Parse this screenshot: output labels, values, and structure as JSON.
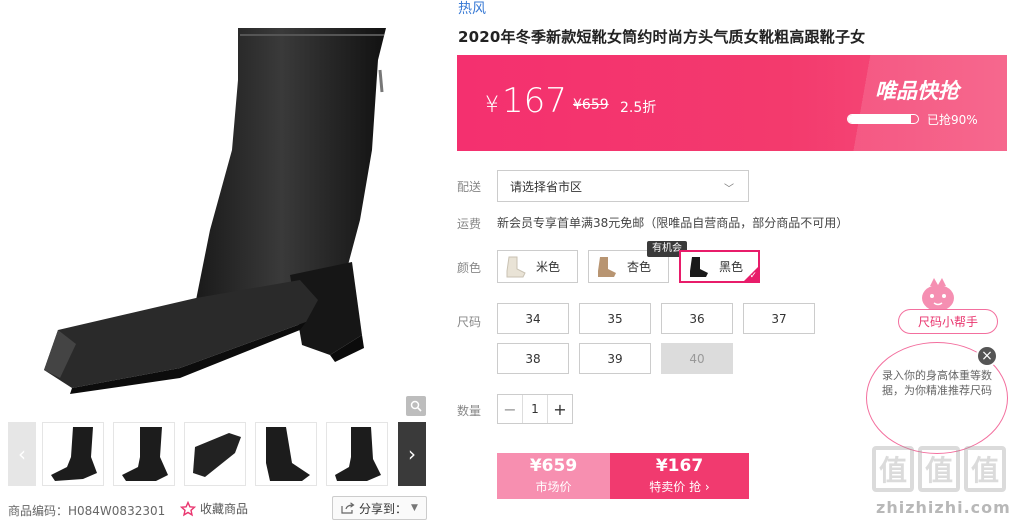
{
  "product": {
    "brand": "热风",
    "title": "2020年冬季新款短靴女筒约时尚方头气质女靴粗高跟靴子女",
    "sku_label": "商品编码：H084W0832301",
    "favorite_label": "收藏商品",
    "share_label": "分享到："
  },
  "price": {
    "current": "167",
    "currency": "¥",
    "original": "¥659",
    "discount": "2.5折"
  },
  "flash_sale": {
    "title": "唯品快抢",
    "progress_text": "已抢90%",
    "progress_fraction": 0.9
  },
  "shipping": {
    "label": "配送",
    "select_value": "请选择省市区"
  },
  "fee": {
    "label": "运费",
    "text": "新会员专享首单满38元免邮（限唯品自营商品，部分商品不可用）"
  },
  "colors": {
    "label": "颜色",
    "chance_badge": "有机会",
    "options": [
      {
        "name": "米色",
        "selected": false
      },
      {
        "name": "杏色",
        "selected": false
      },
      {
        "name": "黑色",
        "selected": true
      }
    ]
  },
  "sizes": {
    "label": "尺码",
    "options": [
      {
        "value": "34",
        "available": true
      },
      {
        "value": "35",
        "available": true
      },
      {
        "value": "36",
        "available": true
      },
      {
        "value": "37",
        "available": true
      },
      {
        "value": "38",
        "available": true
      },
      {
        "value": "39",
        "available": true
      },
      {
        "value": "40",
        "available": false
      }
    ]
  },
  "quantity": {
    "label": "数量",
    "value": "1"
  },
  "buy": {
    "market_price": "¥659",
    "market_label": "市场价",
    "special_price": "¥167",
    "special_label": "特卖价 抢 ›"
  },
  "helper": {
    "tag": "尺码小帮手",
    "bubble": "录入你的身高体重等数据，为你精准推荐尺码"
  },
  "watermark": {
    "logo": "值值值",
    "url": "zhizhizhi.com"
  },
  "colors_palette": {
    "accent": "#f13a6f",
    "link": "#3a7bd5"
  }
}
